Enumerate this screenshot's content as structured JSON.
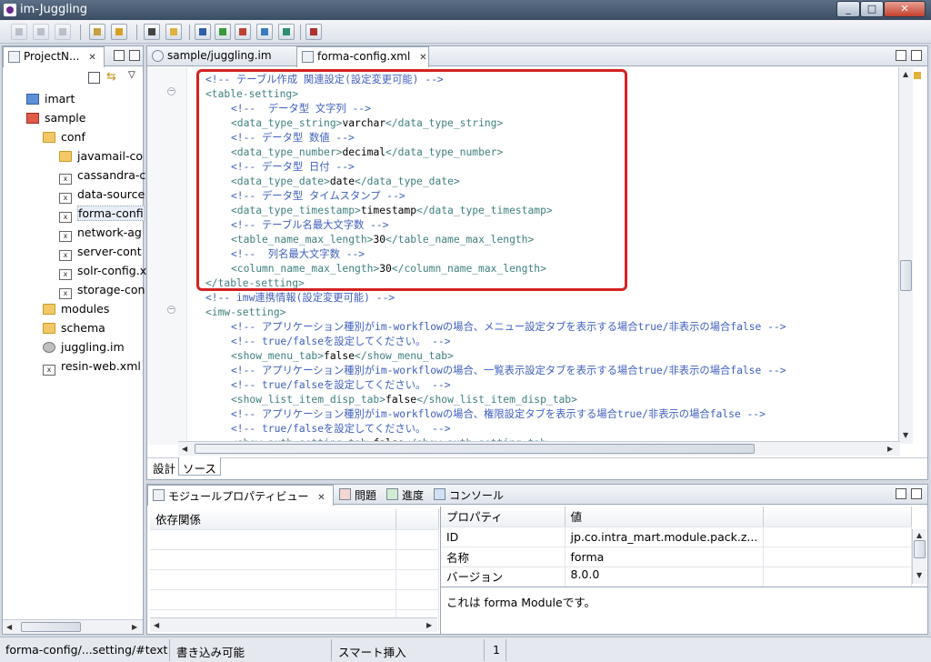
{
  "window": {
    "title": "im-Juggling",
    "minimize": "_",
    "restore": "□",
    "close": "✕"
  },
  "toolbar": {
    "icons": [
      "save-icon",
      "save-as-icon",
      "save-all-icon",
      "build-icon",
      "deploy-icon",
      "module-icon",
      "open-folder-icon",
      "monitor-icon",
      "add-server-icon",
      "user-icon",
      "image-icon",
      "settings-icon",
      "tools-icon"
    ]
  },
  "project_nav": {
    "tab_label": "ProjectN...",
    "tree": [
      {
        "label": "imart",
        "type": "project",
        "depth": 1
      },
      {
        "label": "sample",
        "type": "project-error",
        "depth": 1
      },
      {
        "label": "conf",
        "type": "folder",
        "depth": 2
      },
      {
        "label": "javamail-co",
        "type": "folder",
        "depth": 3
      },
      {
        "label": "cassandra-c",
        "type": "xml",
        "depth": 3
      },
      {
        "label": "data-source",
        "type": "xml",
        "depth": 3
      },
      {
        "label": "forma-confi",
        "type": "xml",
        "depth": 3,
        "selected": true
      },
      {
        "label": "network-ag",
        "type": "xml",
        "depth": 3
      },
      {
        "label": "server-cont",
        "type": "xml",
        "depth": 3
      },
      {
        "label": "solr-config.x",
        "type": "xml",
        "depth": 3
      },
      {
        "label": "storage-con",
        "type": "xml",
        "depth": 3
      },
      {
        "label": "modules",
        "type": "folder",
        "depth": 2
      },
      {
        "label": "schema",
        "type": "folder",
        "depth": 2
      },
      {
        "label": "juggling.im",
        "type": "gear",
        "depth": 2
      },
      {
        "label": "resin-web.xml",
        "type": "xml",
        "depth": 2
      }
    ]
  },
  "editor": {
    "tabs": [
      {
        "label": "sample/juggling.im",
        "active": false
      },
      {
        "label": "forma-config.xml",
        "active": true
      }
    ],
    "lines": [
      {
        "indent": 0,
        "parts": [
          {
            "c": "cm",
            "t": "<!-- テーブル作成 関連設定(設定変更可能) -->"
          }
        ]
      },
      {
        "indent": 0,
        "parts": [
          {
            "c": "tg",
            "t": "<table-setting>"
          }
        ]
      },
      {
        "indent": 1,
        "parts": [
          {
            "c": "cm",
            "t": "<!--  データ型 文字列 -->"
          }
        ]
      },
      {
        "indent": 1,
        "parts": [
          {
            "c": "tg",
            "t": "<data_type_string>"
          },
          {
            "c": "tx",
            "t": "varchar"
          },
          {
            "c": "tg",
            "t": "</data_type_string>"
          }
        ]
      },
      {
        "indent": 1,
        "parts": [
          {
            "c": "cm",
            "t": "<!-- データ型 数値 -->"
          }
        ]
      },
      {
        "indent": 1,
        "parts": [
          {
            "c": "tg",
            "t": "<data_type_number>"
          },
          {
            "c": "tx",
            "t": "decimal"
          },
          {
            "c": "tg",
            "t": "</data_type_number>"
          }
        ]
      },
      {
        "indent": 1,
        "parts": [
          {
            "c": "cm",
            "t": "<!-- データ型 日付 -->"
          }
        ]
      },
      {
        "indent": 1,
        "parts": [
          {
            "c": "tg",
            "t": "<data_type_date>"
          },
          {
            "c": "tx",
            "t": "date"
          },
          {
            "c": "tg",
            "t": "</data_type_date>"
          }
        ]
      },
      {
        "indent": 1,
        "parts": [
          {
            "c": "cm",
            "t": "<!-- データ型 タイムスタンプ -->"
          }
        ]
      },
      {
        "indent": 1,
        "parts": [
          {
            "c": "tg",
            "t": "<data_type_timestamp>"
          },
          {
            "c": "tx",
            "t": "timestamp"
          },
          {
            "c": "tg",
            "t": "</data_type_timestamp>"
          }
        ]
      },
      {
        "indent": 1,
        "parts": [
          {
            "c": "cm",
            "t": "<!-- テーブル名最大文字数 -->"
          }
        ]
      },
      {
        "indent": 1,
        "parts": [
          {
            "c": "tg",
            "t": "<table_name_max_length>"
          },
          {
            "c": "tx",
            "t": "30"
          },
          {
            "c": "tg",
            "t": "</table_name_max_length>"
          }
        ]
      },
      {
        "indent": 1,
        "parts": [
          {
            "c": "cm",
            "t": "<!--  列名最大文字数 -->"
          }
        ]
      },
      {
        "indent": 1,
        "parts": [
          {
            "c": "tg",
            "t": "<column_name_max_length>"
          },
          {
            "c": "tx",
            "t": "30"
          },
          {
            "c": "tg",
            "t": "</column_name_max_length>"
          }
        ]
      },
      {
        "indent": 0,
        "parts": [
          {
            "c": "tg",
            "t": "</table-setting>"
          }
        ]
      },
      {
        "indent": 0,
        "parts": [
          {
            "c": "cm",
            "t": "<!-- imw連携情報(設定変更可能) -->"
          }
        ]
      },
      {
        "indent": 0,
        "parts": [
          {
            "c": "tg",
            "t": "<imw-setting>"
          }
        ]
      },
      {
        "indent": 1,
        "parts": [
          {
            "c": "cm",
            "t": "<!-- アプリケーション種別がim-workflowの場合、メニュー設定タブを表示する場合true/非表示の場合false -->"
          }
        ]
      },
      {
        "indent": 1,
        "parts": [
          {
            "c": "cm",
            "t": "<!-- true/falseを設定してください。 -->"
          }
        ]
      },
      {
        "indent": 1,
        "parts": [
          {
            "c": "tg",
            "t": "<show_menu_tab>"
          },
          {
            "c": "tx",
            "t": "false"
          },
          {
            "c": "tg",
            "t": "</show_menu_tab>"
          }
        ]
      },
      {
        "indent": 1,
        "parts": [
          {
            "c": "cm",
            "t": "<!-- アプリケーション種別がim-workflowの場合、一覧表示設定タブを表示する場合true/非表示の場合false -->"
          }
        ]
      },
      {
        "indent": 1,
        "parts": [
          {
            "c": "cm",
            "t": "<!-- true/falseを設定してください。 -->"
          }
        ]
      },
      {
        "indent": 1,
        "parts": [
          {
            "c": "tg",
            "t": "<show_list_item_disp_tab>"
          },
          {
            "c": "tx",
            "t": "false"
          },
          {
            "c": "tg",
            "t": "</show_list_item_disp_tab>"
          }
        ]
      },
      {
        "indent": 1,
        "parts": [
          {
            "c": "cm",
            "t": "<!-- アプリケーション種別がim-workflowの場合、権限設定タブを表示する場合true/非表示の場合false -->"
          }
        ]
      },
      {
        "indent": 1,
        "parts": [
          {
            "c": "cm",
            "t": "<!-- true/falseを設定してください。 -->"
          }
        ]
      },
      {
        "indent": 1,
        "parts": [
          {
            "c": "tg",
            "t": "<show_auth_setting_tab>"
          },
          {
            "c": "tx",
            "t": "false"
          },
          {
            "c": "tg",
            "t": "</show_auth_setting_tab>"
          }
        ]
      }
    ],
    "bottom_tabs": [
      {
        "label": "設計",
        "active": false
      },
      {
        "label": "ソース",
        "active": true
      }
    ]
  },
  "bottom_panel": {
    "tabs": [
      {
        "label": "モジュールプロパティビュー",
        "active": true,
        "closable": true,
        "icon": "module-properties-icon"
      },
      {
        "label": "問題",
        "active": false,
        "icon": "problems-icon"
      },
      {
        "label": "進度",
        "active": false,
        "icon": "progress-icon"
      },
      {
        "label": "コンソール",
        "active": false,
        "icon": "console-icon"
      }
    ],
    "dependency_header": "依存関係",
    "property_headers": [
      "プロパティ",
      "値"
    ],
    "properties": [
      {
        "key": "ID",
        "value": "jp.co.intra_mart.module.pack.z..."
      },
      {
        "key": "名称",
        "value": "forma"
      },
      {
        "key": "バージョン",
        "value": "8.0.0"
      }
    ],
    "description": "これは forma Moduleです。"
  },
  "status": {
    "path": "forma-config/...setting/#text",
    "mode": "書き込み可能",
    "insert": "スマート挿入",
    "line": "1"
  }
}
